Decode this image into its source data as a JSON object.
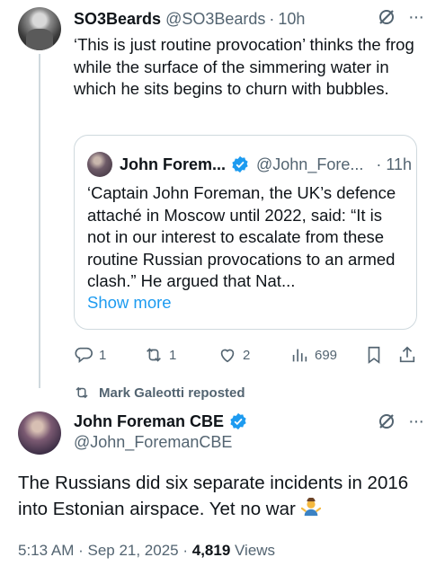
{
  "colors": {
    "text": "#0f1419",
    "muted": "#536471",
    "link": "#1d9bf0",
    "border": "#cfd9de",
    "verified": "#1d9bf0"
  },
  "post": {
    "display_name": "SO3Beards",
    "handle": "@SO3Beards",
    "separator": "·",
    "time": "10h",
    "text": "‘This is just routine provocation’ thinks the frog while the surface of the simmering water in which he sits begins to churn with bubbles.",
    "quote": {
      "display_name": "John Forem...",
      "handle": "@John_Fore...",
      "time": "· 11h",
      "text": "‘Captain John Foreman, the UK’s defence attaché in Moscow until 2022, said: “It is not in our interest to escalate from these routine Russian provocations to an armed clash.” He argued that Nat...",
      "show_more": "Show more"
    },
    "actions": {
      "replies": "1",
      "reposts": "1",
      "likes": "2",
      "views": "699"
    }
  },
  "repost_banner": {
    "text": "Mark Galeotti reposted",
    "icon": "repost-icon"
  },
  "main_post": {
    "display_name": "John Foreman CBE",
    "handle": "@John_ForemanCBE",
    "text": "The Russians did six separate incidents in 2016 into Estonian airspace. Yet no war",
    "emoji": "man-shrugging-emoji",
    "timestamp": "5:13 AM · Sep 21, 2025 · ",
    "views_count": "4,819",
    "views_label": " Views"
  }
}
